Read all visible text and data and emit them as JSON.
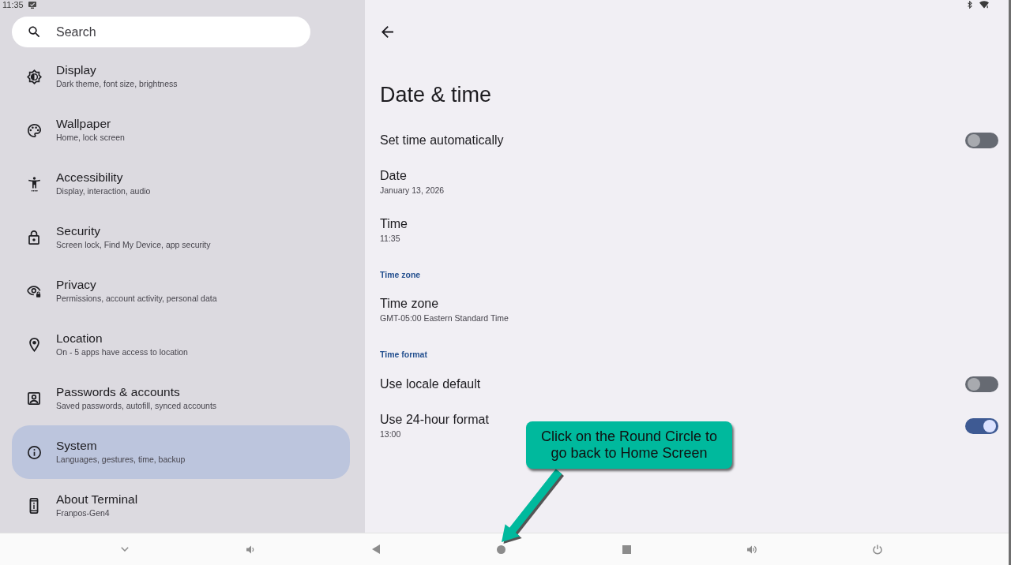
{
  "status_bar": {
    "time": "11:35"
  },
  "sidebar": {
    "search": {
      "placeholder": "Search"
    },
    "items": [
      {
        "title": "Display",
        "subtitle": "Dark theme, font size, brightness",
        "selected": false
      },
      {
        "title": "Wallpaper",
        "subtitle": "Home, lock screen",
        "selected": false
      },
      {
        "title": "Accessibility",
        "subtitle": "Display, interaction, audio",
        "selected": false
      },
      {
        "title": "Security",
        "subtitle": "Screen lock, Find My Device, app security",
        "selected": false
      },
      {
        "title": "Privacy",
        "subtitle": "Permissions, account activity, personal data",
        "selected": false
      },
      {
        "title": "Location",
        "subtitle": "On - 5 apps have access to location",
        "selected": false
      },
      {
        "title": "Passwords & accounts",
        "subtitle": "Saved passwords, autofill, synced accounts",
        "selected": false
      },
      {
        "title": "System",
        "subtitle": "Languages, gestures, time, backup",
        "selected": true
      },
      {
        "title": "About Terminal",
        "subtitle": "Franpos-Gen4",
        "selected": false
      }
    ]
  },
  "page": {
    "title": "Date & time",
    "rows": [
      {
        "kind": "toggle",
        "title": "Set time automatically",
        "on": false
      },
      {
        "kind": "info",
        "title": "Date",
        "summary": "January 13, 2026"
      },
      {
        "kind": "info",
        "title": "Time",
        "summary": "11:35"
      },
      {
        "kind": "header",
        "title": "Time zone"
      },
      {
        "kind": "info",
        "title": "Time zone",
        "summary": "GMT-05:00 Eastern Standard Time"
      },
      {
        "kind": "header",
        "title": "Time format"
      },
      {
        "kind": "toggle",
        "title": "Use locale default",
        "on": false
      },
      {
        "kind": "toggle",
        "title": "Use 24-hour format",
        "summary": "13:00",
        "on": true
      }
    ]
  },
  "callout": {
    "text": "Click on the Round Circle to go back to Home Screen"
  }
}
